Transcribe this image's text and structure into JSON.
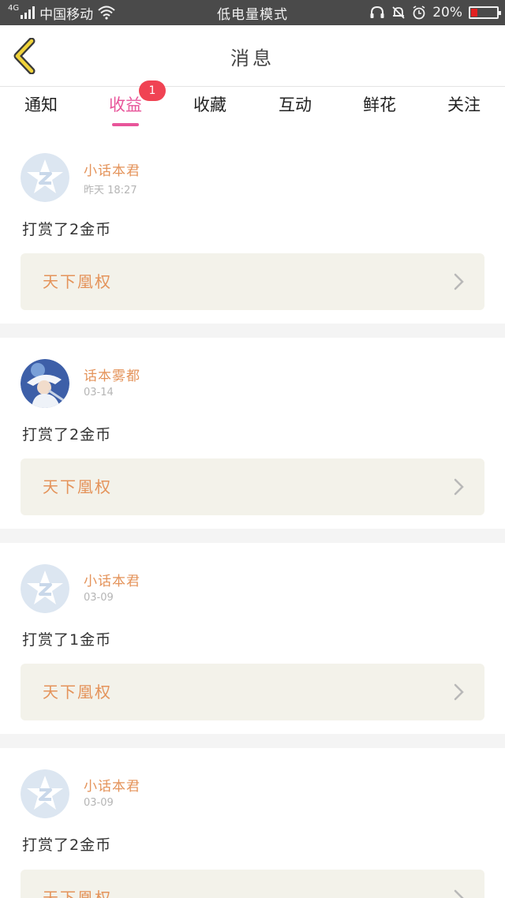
{
  "status_bar": {
    "network": "4G",
    "carrier": "中国移动",
    "mode": "低电量模式",
    "battery": "20%",
    "battery_level": 0.2
  },
  "header": {
    "title": "消息",
    "back_icon": "chevron-left-icon"
  },
  "tabs": [
    {
      "label": "通知",
      "active": false
    },
    {
      "label": "收益",
      "active": true,
      "badge": "1"
    },
    {
      "label": "收藏",
      "active": false
    },
    {
      "label": "互动",
      "active": false
    },
    {
      "label": "鲜花",
      "active": false
    },
    {
      "label": "关注",
      "active": false
    }
  ],
  "colors": {
    "accent_pink": "#e8559a",
    "name_orange": "#e4935a",
    "badge_red": "#f04353",
    "card_bg": "#f3f2ea"
  },
  "messages": [
    {
      "avatar": "default-avatar-icon",
      "name": "小话本君",
      "time": "昨天 18:27",
      "text": "打赏了2金币",
      "book": "天下凰权"
    },
    {
      "avatar": "user-avatar-photo",
      "name": "话本雾都",
      "time": "03-14",
      "text": "打赏了2金币",
      "book": "天下凰权"
    },
    {
      "avatar": "default-avatar-icon",
      "name": "小话本君",
      "time": "03-09",
      "text": "打赏了1金币",
      "book": "天下凰权"
    },
    {
      "avatar": "default-avatar-icon",
      "name": "小话本君",
      "time": "03-09",
      "text": "打赏了2金币",
      "book": "天下凰权"
    }
  ]
}
